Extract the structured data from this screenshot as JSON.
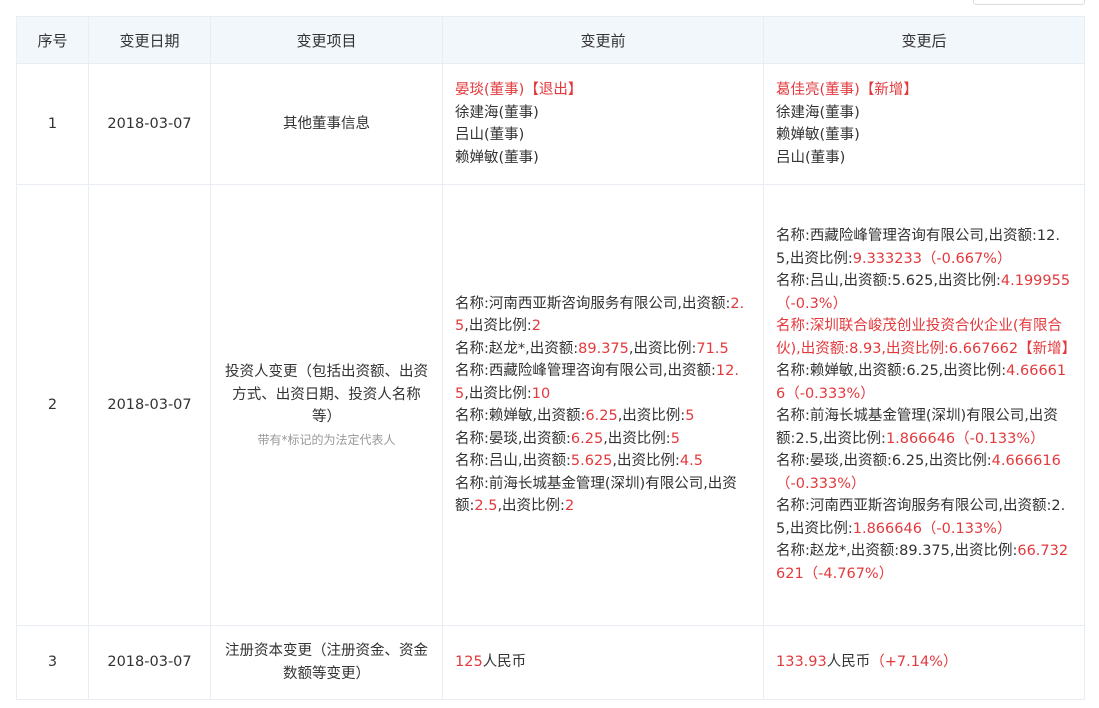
{
  "headers": [
    "序号",
    "变更日期",
    "变更项目",
    "变更前",
    "变更后"
  ],
  "rows": [
    {
      "index": "1",
      "date": "2018-03-07",
      "item": "其他董事信息",
      "before": [
        [
          {
            "t": "晏琰(董事)【退出】",
            "red": true
          }
        ],
        [
          {
            "t": "徐建海(董事)"
          }
        ],
        [
          {
            "t": "吕山(董事)"
          }
        ],
        [
          {
            "t": "赖婵敏(董事)"
          }
        ]
      ],
      "after": [
        [
          {
            "t": "葛佳亮(董事)【新增】",
            "red": true
          }
        ],
        [
          {
            "t": "徐建海(董事)"
          }
        ],
        [
          {
            "t": "赖婵敏(董事)"
          }
        ],
        [
          {
            "t": "吕山(董事)"
          }
        ]
      ]
    },
    {
      "index": "2",
      "date": "2018-03-07",
      "item": "投资人变更（包括出资额、出资方式、出资日期、投资人名称等）",
      "note": "带有*标记的为法定代表人",
      "before": [
        [
          {
            "t": "名称:河南西亚斯咨询服务有限公司,出资额:"
          },
          {
            "t": "2.5",
            "red": true
          },
          {
            "t": ",出资比例:"
          },
          {
            "t": "2",
            "red": true
          }
        ],
        [
          {
            "t": "名称:赵龙*,出资额:"
          },
          {
            "t": "89.375",
            "red": true
          },
          {
            "t": ",出资比例:"
          },
          {
            "t": "71.5",
            "red": true
          }
        ],
        [
          {
            "t": "名称:西藏险峰管理咨询有限公司,出资额:"
          },
          {
            "t": "12.5",
            "red": true
          },
          {
            "t": ",出资比例:"
          },
          {
            "t": "10",
            "red": true
          }
        ],
        [
          {
            "t": "名称:赖婵敏,出资额:"
          },
          {
            "t": "6.25",
            "red": true
          },
          {
            "t": ",出资比例:"
          },
          {
            "t": "5",
            "red": true
          }
        ],
        [
          {
            "t": "名称:晏琰,出资额:"
          },
          {
            "t": "6.25",
            "red": true
          },
          {
            "t": ",出资比例:"
          },
          {
            "t": "5",
            "red": true
          }
        ],
        [
          {
            "t": "名称:吕山,出资额:"
          },
          {
            "t": "5.625",
            "red": true
          },
          {
            "t": ",出资比例:"
          },
          {
            "t": "4.5",
            "red": true
          }
        ],
        [
          {
            "t": "名称:前海长城基金管理(深圳)有限公司,出资额:"
          },
          {
            "t": "2.5",
            "red": true
          },
          {
            "t": ",出资比例:"
          },
          {
            "t": "2",
            "red": true
          }
        ]
      ],
      "after": [
        [
          {
            "t": "名称:西藏险峰管理咨询有限公司,出资额:12.5,出资比例:"
          },
          {
            "t": "9.333233（-0.667%）",
            "red": true
          }
        ],
        [
          {
            "t": "名称:吕山,出资额:5.625,出资比例:"
          },
          {
            "t": "4.199955（-0.3%）",
            "red": true
          }
        ],
        [
          {
            "t": "名称:深圳联合峻茂创业投资合伙企业(有限合伙),出资额:8.93,出资比例:6.667662【新增】",
            "red": true
          }
        ],
        [
          {
            "t": "名称:赖婵敏,出资额:6.25,出资比例:"
          },
          {
            "t": "4.666616（-0.333%）",
            "red": true
          }
        ],
        [
          {
            "t": "名称:前海长城基金管理(深圳)有限公司,出资额:2.5,出资比例:"
          },
          {
            "t": "1.866646（-0.133%）",
            "red": true
          }
        ],
        [
          {
            "t": "名称:晏琰,出资额:6.25,出资比例:"
          },
          {
            "t": "4.666616（-0.333%）",
            "red": true
          }
        ],
        [
          {
            "t": "名称:河南西亚斯咨询服务有限公司,出资额:2.5,出资比例:"
          },
          {
            "t": "1.866646（-0.133%）",
            "red": true
          }
        ],
        [
          {
            "t": "名称:赵龙*,出资额:89.375,出资比例:"
          },
          {
            "t": "66.732621（-4.767%）",
            "red": true
          }
        ]
      ]
    },
    {
      "index": "3",
      "date": "2018-03-07",
      "item": "注册资本变更（注册资金、资金数额等变更）",
      "before": [
        [
          {
            "t": "125",
            "red": true
          },
          {
            "t": "人民币"
          }
        ]
      ],
      "after": [
        [
          {
            "t": "133.93",
            "red": true
          },
          {
            "t": "人民币"
          },
          {
            "t": "（+7.14%）",
            "red": true
          }
        ]
      ]
    }
  ]
}
